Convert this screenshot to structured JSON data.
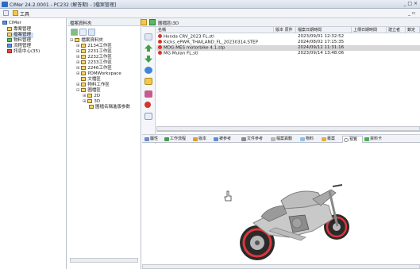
{
  "window": {
    "title": "CIMer 24.2.0001 - PC232 (解答期) - [檔案管理]",
    "controls": "_ □ ×"
  },
  "menubar": {
    "items": [
      "工具"
    ]
  },
  "left_nav": {
    "root": "CIMer",
    "items": [
      {
        "label": "專案管理",
        "icon": "folder"
      },
      {
        "label": "檔案管理",
        "icon": "folder",
        "selected": true
      },
      {
        "label": "物料管理",
        "icon": "gear"
      },
      {
        "label": "流程管理",
        "icon": "flow"
      },
      {
        "label": "訊息中心(35)",
        "icon": "mail"
      }
    ]
  },
  "file_tree": {
    "header": "檔案資料夾",
    "nodes": [
      {
        "label": "檔案資料夾",
        "depth": 0
      },
      {
        "label": "2134工作區",
        "depth": 1
      },
      {
        "label": "2231工作區",
        "depth": 1
      },
      {
        "label": "2232工作區",
        "depth": 1
      },
      {
        "label": "2233工作區",
        "depth": 1
      },
      {
        "label": "2246工作區",
        "depth": 1
      },
      {
        "label": "PDMWorkspace",
        "depth": 1
      },
      {
        "label": "文檔區",
        "depth": 1
      },
      {
        "label": "物料工作區",
        "depth": 1
      },
      {
        "label": "圖檔區",
        "depth": 1
      },
      {
        "label": "2D",
        "depth": 2
      },
      {
        "label": "3D",
        "depth": 2
      },
      {
        "label": "圖檔名稱進版参数",
        "depth": 3
      }
    ]
  },
  "breadcrumb": {
    "label": "圖檔區\\3D"
  },
  "file_grid": {
    "columns": [
      "名稱",
      "版本 原件",
      "檔案日期時間",
      "上傳日期時間",
      "建立者",
      "鎖定"
    ],
    "rows": [
      {
        "name": "Honda CRV_2023 FL.stl",
        "date": "2023/09/01 12:32:52",
        "selected": false
      },
      {
        "name": "Kicks_ePWR_THAILAND_FL_20230314.STEP",
        "date": "2024/08/02 17:15:35",
        "selected": false
      },
      {
        "name": "MDG-MES motorbike 4.1.stp",
        "date": "2024/09/12 11:31:16",
        "selected": true
      },
      {
        "name": "MG Mulan FL.stl",
        "date": "2023/09/14 13:48:06",
        "selected": false
      }
    ]
  },
  "detail_tabs": [
    {
      "label": "屬性",
      "icon_color": "#6a8cc7"
    },
    {
      "label": "工作流程",
      "icon_color": "#4c9a4c"
    },
    {
      "label": "版本",
      "icon_color": "#d8a237"
    },
    {
      "label": "被參考",
      "icon_color": "#5b8fd6"
    },
    {
      "label": "文件參考",
      "icon_color": "#8a8a8a"
    },
    {
      "label": "檔案異動",
      "icon_color": "#b8b8b8"
    },
    {
      "label": "物料",
      "icon_color": "#8fc0e8"
    },
    {
      "label": "專案",
      "icon_color": "#e2b040"
    },
    {
      "label": "預覽",
      "icon_color": "#ffffff",
      "active": true
    },
    {
      "label": "資料卡",
      "icon_color": "#4caf50"
    }
  ],
  "colors": {
    "accent": "#2b6cc4",
    "selected_row": "#d8d8d8",
    "file_icon": "#d8342a"
  }
}
